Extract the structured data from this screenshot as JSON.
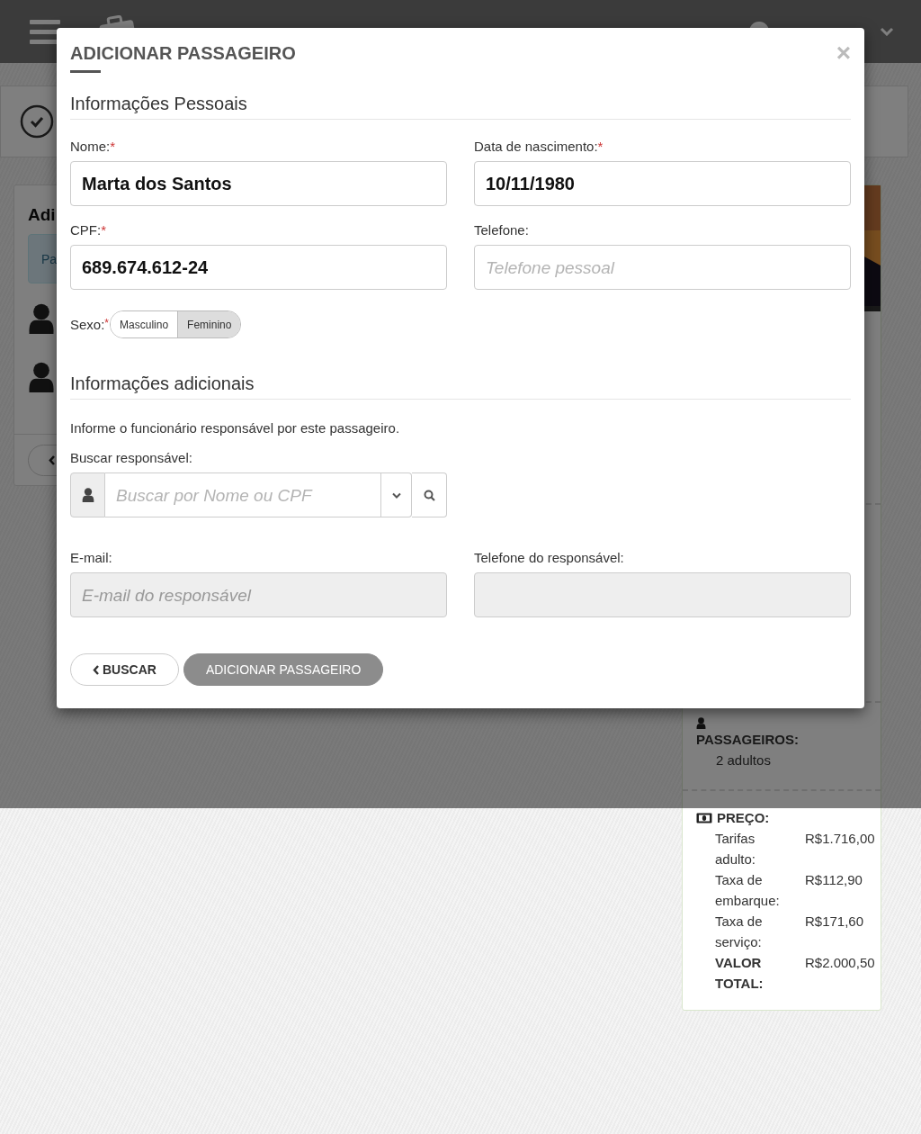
{
  "background_card": {
    "title": "Adi",
    "info": "Pa"
  },
  "summary": {
    "passengers_label": "PASSAGEIROS:",
    "passengers_value": "2 adultos",
    "price_label": "PREÇO:",
    "price_rows": [
      {
        "label": "Tarifas adulto:",
        "value": "R$1.716,00",
        "kind": "item"
      },
      {
        "label": "Taxa de embarque:",
        "value": "R$112,90",
        "kind": "item"
      },
      {
        "label": "Taxa de serviço:",
        "value": "R$171,60",
        "kind": "item"
      },
      {
        "label": "VALOR TOTAL:",
        "value": "R$2.000,50",
        "kind": "total"
      }
    ]
  },
  "modal": {
    "title": "ADICIONAR PASSAGEIRO",
    "close": "×",
    "personal_section": "Informações Pessoais",
    "fields": [
      {
        "label": "Nome:",
        "required_mark": "*",
        "value": "Marta dos Santos"
      },
      {
        "label": "Data de nascimento:",
        "required_mark": "*",
        "value": "10/11/1980"
      },
      {
        "label": "CPF:",
        "required_mark": "*",
        "value": "689.674.612-24"
      },
      {
        "label": "Telefone:",
        "placeholder": "Telefone pessoal"
      }
    ],
    "sex": {
      "label": "Sexo:",
      "required_mark": "*",
      "options": [
        {
          "label": "Masculino",
          "selected": false
        },
        {
          "label": "Feminino",
          "selected": true
        }
      ]
    },
    "additional_section": "Informações adicionais",
    "hint": "Informe o funcionário responsável por este passageiro.",
    "search": {
      "label": "Buscar responsável:",
      "placeholder": "Buscar por Nome ou CPF"
    },
    "contact_fields": [
      {
        "label": "E-mail:",
        "placeholder": "E-mail do responsável",
        "disabled": true
      },
      {
        "label": "Telefone do responsável:",
        "disabled": true
      }
    ],
    "buttons": [
      {
        "label": "BUSCAR",
        "kind": "back"
      },
      {
        "label": "ADICIONAR PASSAGEIRO",
        "kind": "primary",
        "disabled": true
      }
    ]
  }
}
